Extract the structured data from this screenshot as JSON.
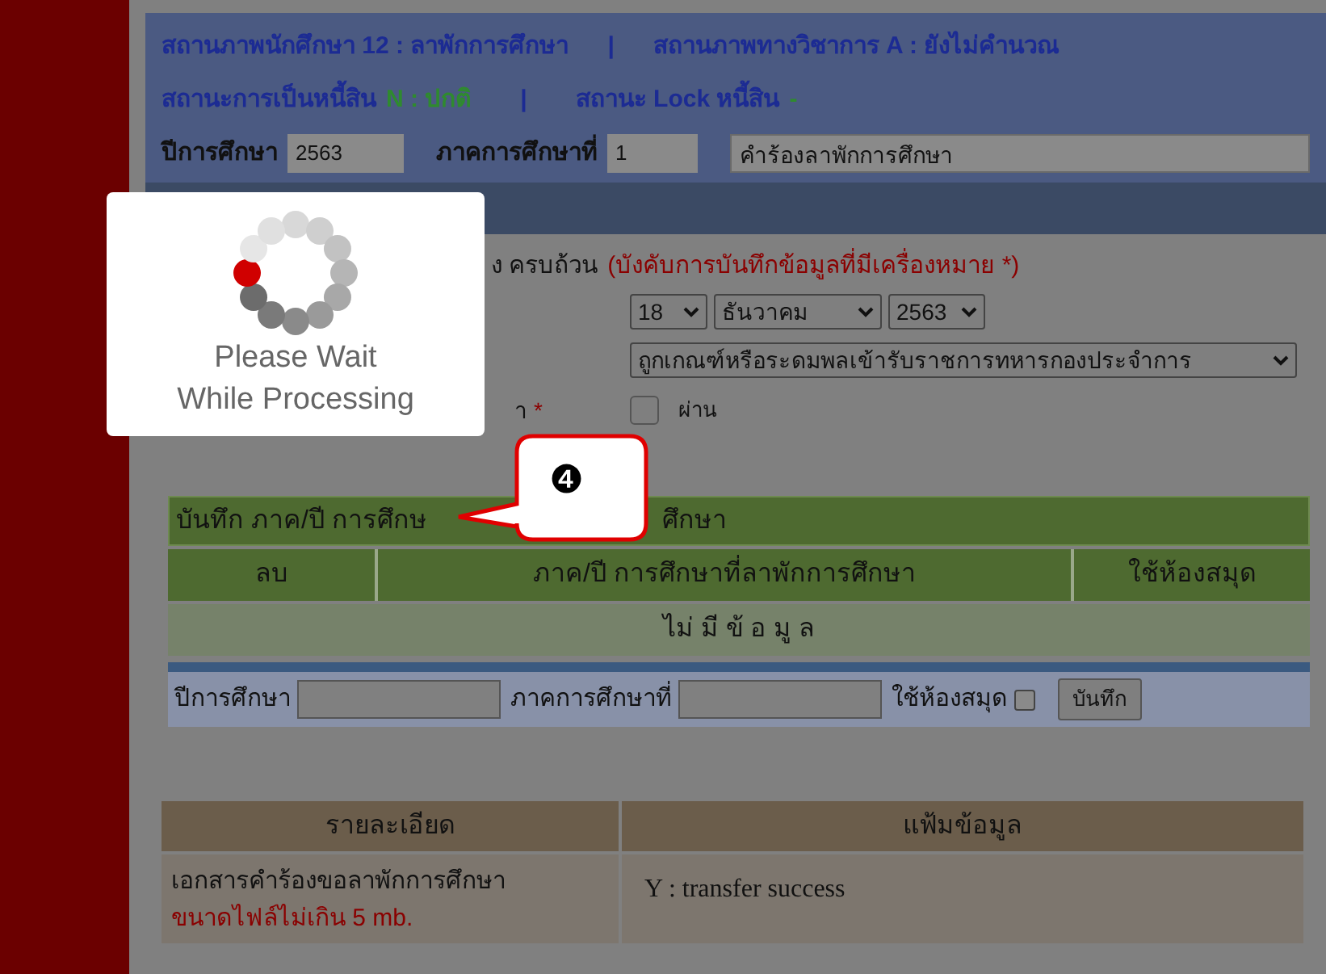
{
  "status": {
    "student_status": "สถานภาพนักศึกษา 12 : ลาพักการศึกษา",
    "separator_1": "|",
    "academic_status": "สถานภาพทางวิชาการ A : ยังไม่คำนวณ",
    "debt_label": "สถานะการเป็นหนี้สิน",
    "debt_value": "N : ปกติ",
    "separator_2": "|",
    "lock_label": "สถานะ Lock หนี้สิน",
    "lock_value": "-"
  },
  "term_bar": {
    "year_label": "ปีการศึกษา",
    "year_value": "2563",
    "semester_label": "ภาคการศึกษาที่",
    "semester_value": "1",
    "request_type": "คำร้องลาพักการศึกษา"
  },
  "form": {
    "heading_fragment": "ง ครบถ้วน",
    "required_note": "(บังคับการบันทึกข้อมูลที่มีเครื่องหมาย *)",
    "date": {
      "day": "18",
      "month": "ธันวาคม",
      "year": "2563"
    },
    "reason": "ถูกเกณฑ์หรือระดมพลเข้ารับราชการทหารกองประจำการ",
    "label_fragment": "า",
    "required_mark": "*",
    "pass_checkbox": {
      "label": "ผ่าน",
      "checked": false
    }
  },
  "semester_table": {
    "title_parts": [
      "บันทึก ภาค/ปี การศึกษ",
      "ศึกษา"
    ],
    "columns": [
      "ลบ",
      "ภาค/ปี การศึกษาที่ลาพักการศึกษา",
      "ใช้ห้องสมุด"
    ],
    "empty_message": "ไม่ มี ข้ อ มู ล"
  },
  "add_row": {
    "year_label": "ปีการศึกษา",
    "semester_label": "ภาคการศึกษาที่",
    "library_label": "ใช้ห้องสมุด",
    "library_checked": false,
    "save_button": "บันทึก"
  },
  "documents_table": {
    "columns": [
      "รายละเอียด",
      "แฟ้มข้อมูล"
    ],
    "rows": [
      {
        "description": "เอกสารคำร้องขอลาพักการศึกษา",
        "size_note": "ขนาดไฟล์ไม่เกิน 5 mb.",
        "file_status": "Y : transfer success"
      }
    ]
  },
  "loading_dialog": {
    "message_lines": [
      "Please Wait",
      "While Processing"
    ]
  },
  "callout": {
    "label": "❹"
  }
}
